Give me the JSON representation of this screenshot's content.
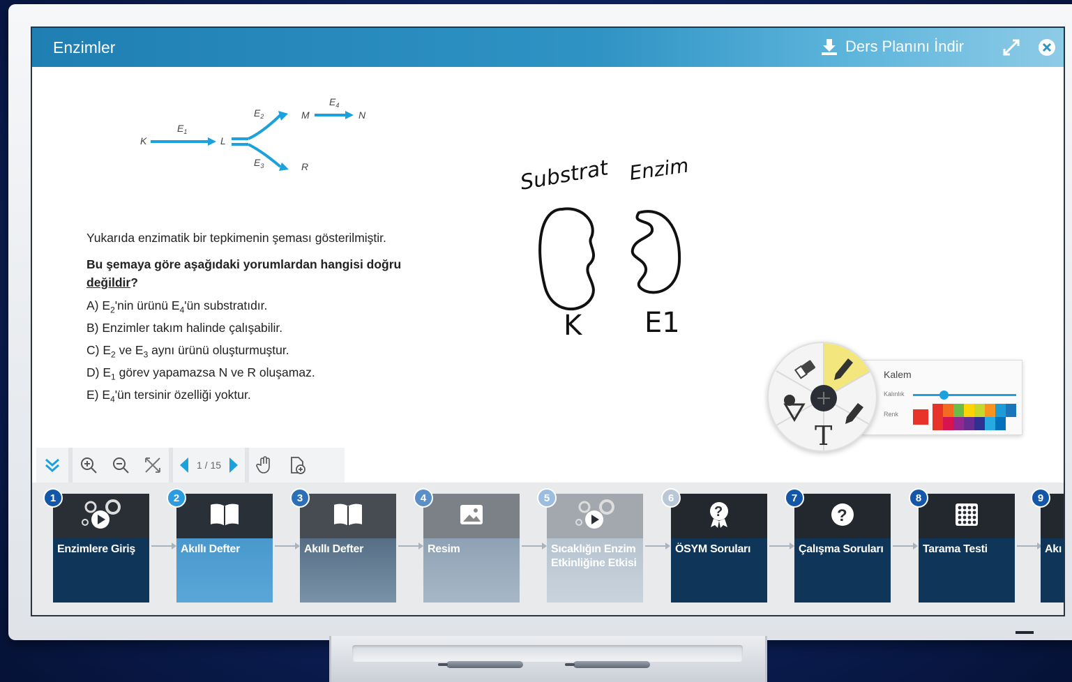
{
  "window": {
    "title": "Enzimler",
    "download_label": "Ders Planını İndir",
    "icons": [
      "download-icon",
      "expand-icon",
      "close-icon"
    ]
  },
  "diagram": {
    "nodes": [
      "K",
      "L",
      "M",
      "N",
      "R"
    ],
    "enzymes": [
      "E1",
      "E2",
      "E3",
      "E4"
    ]
  },
  "question": {
    "intro": "Yukarıda enzimatik bir tepkimenin şeması gösterilmiştir.",
    "stem_bold": "Bu şemaya göre aşağıdaki yorumlardan hangisi doğru",
    "stem_underline": "değildir",
    "stem_end": "?",
    "options": [
      {
        "letter": "A)",
        "parts": [
          "E",
          "2",
          "'nin ürünü E",
          "4",
          "'ün substratıdır."
        ]
      },
      {
        "letter": "B)",
        "parts": [
          "Enzimler takım halinde çalışabilir."
        ]
      },
      {
        "letter": "C)",
        "parts": [
          "E",
          "2",
          " ve E",
          "3",
          " aynı ürünü oluşturmuştur."
        ]
      },
      {
        "letter": "D)",
        "parts": [
          "E",
          "1",
          " görev yapamazsa N ve R oluşamaz."
        ]
      },
      {
        "letter": "E)",
        "parts": [
          "E",
          "4",
          "'ün tersinir özelliği yoktur."
        ]
      }
    ]
  },
  "handwriting": {
    "left_word": "Substrat",
    "right_word": "Enzim",
    "left_label": "K",
    "right_label": "E1"
  },
  "pen_panel": {
    "title": "Kalem",
    "thickness_label": "Kalınlık",
    "color_label": "Renk",
    "thickness_value": 0.3,
    "selected_color": "#e8332a",
    "palette": [
      "#e8332a",
      "#f26b21",
      "#6cbd45",
      "#ffd400",
      "#c5d92d",
      "#f7931e",
      "#1d9bd7",
      "#1b75bb",
      "#e8332a",
      "#d7144f",
      "#92278f",
      "#662d91",
      "#2e3192",
      "#27aae1",
      "#0072bc"
    ]
  },
  "toolbar": {
    "page_current": "1",
    "page_total": "15",
    "page_text": "1 / 15"
  },
  "lessons": [
    {
      "num": "1",
      "label": "Enzimlere Giriş",
      "icon": "video-icon"
    },
    {
      "num": "2",
      "label": "Akıllı Defter",
      "icon": "book-icon"
    },
    {
      "num": "3",
      "label": "Akıllı Defter",
      "icon": "book-icon"
    },
    {
      "num": "4",
      "label": "Resim",
      "icon": "image-icon"
    },
    {
      "num": "5",
      "label": "Sıcaklığın Enzim Etkinliğine Etkisi",
      "icon": "video-icon"
    },
    {
      "num": "6",
      "label": "ÖSYM Soruları",
      "icon": "award-question-icon"
    },
    {
      "num": "7",
      "label": "Çalışma Soruları",
      "icon": "question-icon"
    },
    {
      "num": "8",
      "label": "Tarama Testi",
      "icon": "test-grid-icon"
    },
    {
      "num": "9",
      "label": "Akı",
      "icon": "book-icon"
    }
  ]
}
